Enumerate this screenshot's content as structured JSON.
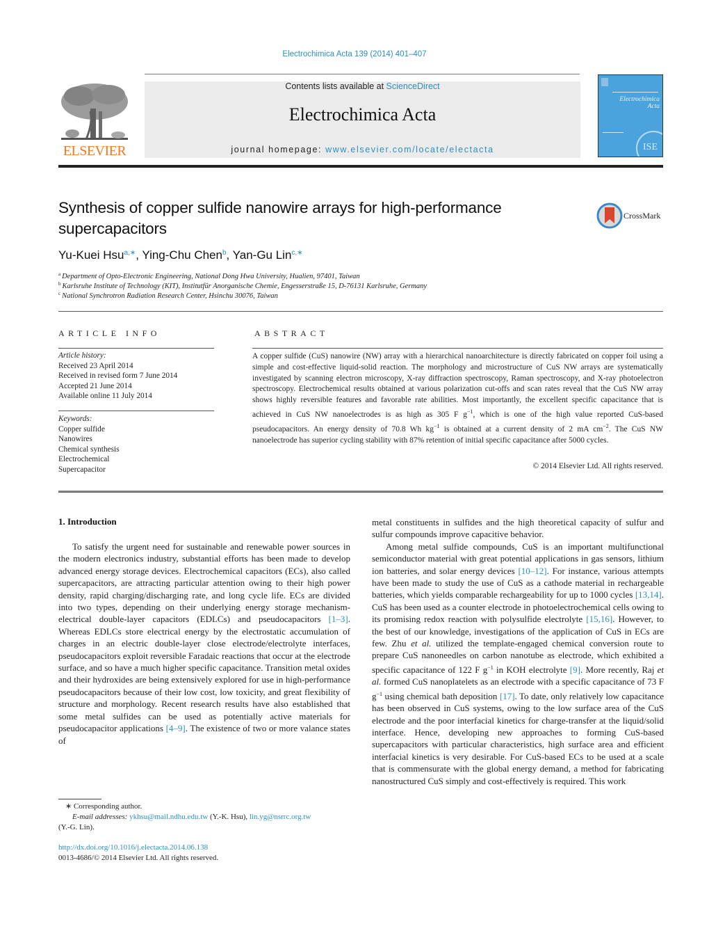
{
  "header": {
    "journal_ref": "Electrochimica Acta 139 (2014) 401–407",
    "contents_prefix": "Contents lists available at ",
    "contents_link": "ScienceDirect",
    "journal_title": "Electrochimica Acta",
    "homepage_prefix": "journal homepage: ",
    "homepage_link": "www.elsevier.com/locate/electacta",
    "publisher_logo_text": "ELSEVIER",
    "cover_title_line1": "Electrochimica",
    "cover_title_line2": "Acta",
    "cover_badge": "ISE",
    "crossmark_label": "CrossMark"
  },
  "article": {
    "title": "Synthesis of copper sulfide nanowire arrays for high-performance supercapacitors",
    "authors": [
      {
        "name": "Yu-Kuei Hsu",
        "sup": "a,∗"
      },
      {
        "name": "Ying-Chu Chen",
        "sup": "b"
      },
      {
        "name": "Yan-Gu Lin",
        "sup": "c,∗"
      }
    ],
    "affiliations": [
      {
        "mark": "a",
        "text": "Department of Opto-Electronic Engineering, National Dong Hwa University, Hualien, 97401, Taiwan"
      },
      {
        "mark": "b",
        "text": "Karlsruhe Institute of Technology (KIT), Institutfür Anorganische Chemie, Engesserstraße 15, D-76131 Karlsruhe, Germany"
      },
      {
        "mark": "c",
        "text": "National Synchrotron Radiation Research Center, Hsinchu 30076, Taiwan"
      }
    ]
  },
  "article_info": {
    "heading": "ARTICLE INFO",
    "history_label": "Article history:",
    "history": [
      "Received 23 April 2014",
      "Received in revised form 7 June 2014",
      "Accepted 21 June 2014",
      "Available online 11 July 2014"
    ],
    "keywords_label": "Keywords:",
    "keywords": [
      "Copper sulfide",
      "Nanowires",
      "Chemical synthesis",
      "Electrochemical",
      "Supercapacitor"
    ]
  },
  "abstract": {
    "heading": "ABSTRACT",
    "text_1": "A copper sulfide (CuS) nanowire (NW) array with a hierarchical nanoarchitecture is directly fabricated on copper foil using a simple and cost-effective liquid-solid reaction. The morphology and microstructure of CuS NW arrays are systematically investigated by scanning electron microscopy, X-ray diffraction spectroscopy, Raman spectroscopy, and X-ray photoelectron spectroscopy. Electrochemical results obtained at various polarization cut-offs and scan rates reveal that the CuS NW array shows highly reversible features and favorable rate abilities. Most importantly, the excellent specific capacitance that is achieved in CuS NW nanoelectrodes is as high as 305 F g",
    "exp_1": "−1",
    "text_2": ", which is one of the high value reported CuS-based pseudocapacitors. An energy density of 70.8 Wh kg",
    "exp_2": "−1",
    "text_3": " is obtained at a current density of 2 mA cm",
    "exp_3": "−2",
    "text_4": ". The CuS NW nanoelectrode has superior cycling stability with 87% retention of initial specific capacitance after 5000 cycles.",
    "copyright": "© 2014 Elsevier Ltd. All rights reserved."
  },
  "introduction": {
    "heading": "1.  Introduction",
    "left_p1_a": "To satisfy the urgent need for sustainable and renewable power sources in the modern electronics industry, substantial efforts has been made to develop advanced energy storage devices. Electrochemical capacitors (ECs), also called supercapacitors, are attracting particular attention owing to their high power density, rapid charging/discharging rate, and long cycle life. ECs are divided into two types, depending on their underlying energy storage mechanism- electrical double-layer capacitors (EDLCs) and pseudocapacitors ",
    "ref_1_3": "[1–3]",
    "left_p1_b": ". Whereas EDLCs store electrical energy by the electrostatic accumulation of charges in an electric double-layer close electrode/electrolyte interfaces, pseudocapacitors exploit reversible Faradaic reactions that occur at the electrode surface, and so have a much higher specific capacitance. Transition metal oxides and their hydroxides are being extensively explored for use in high-performance pseudocapacitors because of their low cost, low toxicity, and great flexibility of structure and morphology. Recent research results have also established that some metal sulfides can be used as potentially active materials for pseudocapacitor applications ",
    "ref_4_9": "[4–9]",
    "left_p1_c": ". The existence of two or more valance states of",
    "right_p1": "metal constituents in sulfides and the high theoretical capacity of sulfur and sulfur compounds improve capacitive behavior.",
    "right_p2_a": "Among metal sulfide compounds, CuS is an important multifunctional semiconductor material with great potential applications in gas sensors, lithium ion batteries, and solar energy devices ",
    "ref_10_12": "[10–12]",
    "right_p2_b": ". For instance, various attempts have been made to study the use of CuS as a cathode material in rechargeable batteries, which yields comparable rechargeability for up to 1000 cycles ",
    "ref_13_14": "[13,14]",
    "right_p2_c": ". CuS has been used as a counter electrode in photoelectrochemical cells owing to its promising redox reaction with polysulfide electrolyte ",
    "ref_15_16": "[15,16]",
    "right_p2_d": ". However, to the best of our knowledge, investigations of the application of CuS in ECs are few. Zhu ",
    "etal_1": "et al.",
    "right_p2_e": " utilized the template-engaged chemical conversion route to prepare CuS nanoneedles on carbon nanotube as electrode, which exhibited a specific capacitance of 122 F g",
    "exp_a": "−1",
    "right_p2_f": " in KOH electrolyte ",
    "ref_9": "[9]",
    "right_p2_g": ". More recently, Raj ",
    "etal_2": "et al.",
    "right_p2_h": " formed CuS nanoplatelets as an electrode with a specific capacitance of 73 F g",
    "exp_b": "−1",
    "right_p2_i": " using chemical bath deposition ",
    "ref_17": "[17]",
    "right_p2_j": ". To date, only relatively low capacitance has been observed in CuS systems, owing to the low surface area of the CuS electrode and the poor interfacial kinetics for charge-transfer at the liquid/solid interface. Hence, developing new approaches to forming CuS-based supercapacitors with particular characteristics, high surface area and efficient interfacial kinetics is very desirable. For CuS-based ECs to be used at a scale that is commensurate with the global energy demand, a method for fabricating nanostructured CuS simply and cost-effectively is required. This work"
  },
  "footnotes": {
    "corresponding": "∗  Corresponding author.",
    "email_label": "E-mail addresses:",
    "email_1": "ykhsu@mail.ndhu.edu.tw",
    "email_1_owner": " (Y.-K. Hsu), ",
    "email_2": "lin.yg@nsrrc.org.tw",
    "email_2_owner": "(Y.-G. Lin).",
    "doi": "http://dx.doi.org/10.1016/j.electacta.2014.06.138",
    "issn_copyright": "0013-4686/© 2014 Elsevier Ltd. All rights reserved."
  },
  "colors": {
    "link": "#2b8fc0",
    "elsevier_orange": "#f07a22",
    "cover_blue": "#4aa3dd",
    "header_box": "#ebebeb"
  }
}
